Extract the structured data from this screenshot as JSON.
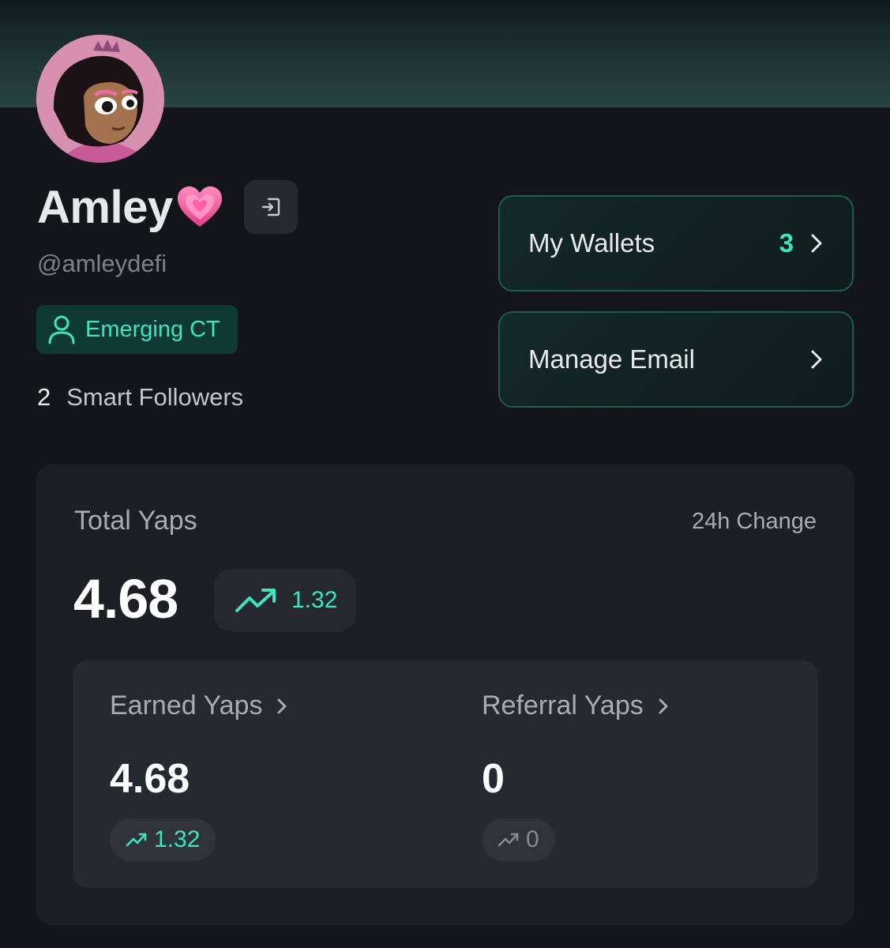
{
  "profile": {
    "name": "Amley",
    "handle": "@amleydefi",
    "tier_badge": "Emerging CT",
    "smart_followers_count": "2",
    "smart_followers_label": "Smart Followers"
  },
  "actions": {
    "wallets_label": "My Wallets",
    "wallets_count": "3",
    "email_label": "Manage Email"
  },
  "yaps": {
    "total_label": "Total Yaps",
    "change_label": "24h Change",
    "total_value": "4.68",
    "total_change": "1.32",
    "earned_label": "Earned Yaps",
    "earned_value": "4.68",
    "earned_change": "1.32",
    "referral_label": "Referral Yaps",
    "referral_value": "0",
    "referral_change": "0"
  },
  "colors": {
    "accent": "#3de3c2",
    "background": "#131519",
    "panel": "#1c1f24",
    "heart": "#f25a9b"
  },
  "icons": [
    "heart-icon",
    "logout-icon",
    "user-icon",
    "chevron-right-icon",
    "trending-up-icon"
  ]
}
